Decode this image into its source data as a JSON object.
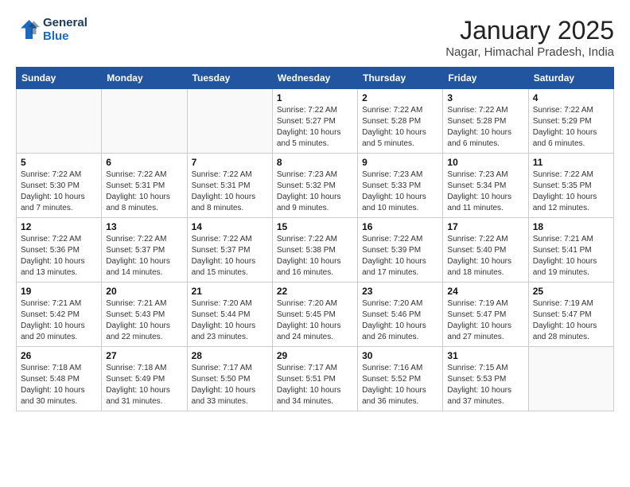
{
  "header": {
    "logo_line1": "General",
    "logo_line2": "Blue",
    "title": "January 2025",
    "subtitle": "Nagar, Himachal Pradesh, India"
  },
  "weekdays": [
    "Sunday",
    "Monday",
    "Tuesday",
    "Wednesday",
    "Thursday",
    "Friday",
    "Saturday"
  ],
  "weeks": [
    [
      {
        "day": "",
        "info": ""
      },
      {
        "day": "",
        "info": ""
      },
      {
        "day": "",
        "info": ""
      },
      {
        "day": "1",
        "info": "Sunrise: 7:22 AM\nSunset: 5:27 PM\nDaylight: 10 hours\nand 5 minutes."
      },
      {
        "day": "2",
        "info": "Sunrise: 7:22 AM\nSunset: 5:28 PM\nDaylight: 10 hours\nand 5 minutes."
      },
      {
        "day": "3",
        "info": "Sunrise: 7:22 AM\nSunset: 5:28 PM\nDaylight: 10 hours\nand 6 minutes."
      },
      {
        "day": "4",
        "info": "Sunrise: 7:22 AM\nSunset: 5:29 PM\nDaylight: 10 hours\nand 6 minutes."
      }
    ],
    [
      {
        "day": "5",
        "info": "Sunrise: 7:22 AM\nSunset: 5:30 PM\nDaylight: 10 hours\nand 7 minutes."
      },
      {
        "day": "6",
        "info": "Sunrise: 7:22 AM\nSunset: 5:31 PM\nDaylight: 10 hours\nand 8 minutes."
      },
      {
        "day": "7",
        "info": "Sunrise: 7:22 AM\nSunset: 5:31 PM\nDaylight: 10 hours\nand 8 minutes."
      },
      {
        "day": "8",
        "info": "Sunrise: 7:23 AM\nSunset: 5:32 PM\nDaylight: 10 hours\nand 9 minutes."
      },
      {
        "day": "9",
        "info": "Sunrise: 7:23 AM\nSunset: 5:33 PM\nDaylight: 10 hours\nand 10 minutes."
      },
      {
        "day": "10",
        "info": "Sunrise: 7:23 AM\nSunset: 5:34 PM\nDaylight: 10 hours\nand 11 minutes."
      },
      {
        "day": "11",
        "info": "Sunrise: 7:22 AM\nSunset: 5:35 PM\nDaylight: 10 hours\nand 12 minutes."
      }
    ],
    [
      {
        "day": "12",
        "info": "Sunrise: 7:22 AM\nSunset: 5:36 PM\nDaylight: 10 hours\nand 13 minutes."
      },
      {
        "day": "13",
        "info": "Sunrise: 7:22 AM\nSunset: 5:37 PM\nDaylight: 10 hours\nand 14 minutes."
      },
      {
        "day": "14",
        "info": "Sunrise: 7:22 AM\nSunset: 5:37 PM\nDaylight: 10 hours\nand 15 minutes."
      },
      {
        "day": "15",
        "info": "Sunrise: 7:22 AM\nSunset: 5:38 PM\nDaylight: 10 hours\nand 16 minutes."
      },
      {
        "day": "16",
        "info": "Sunrise: 7:22 AM\nSunset: 5:39 PM\nDaylight: 10 hours\nand 17 minutes."
      },
      {
        "day": "17",
        "info": "Sunrise: 7:22 AM\nSunset: 5:40 PM\nDaylight: 10 hours\nand 18 minutes."
      },
      {
        "day": "18",
        "info": "Sunrise: 7:21 AM\nSunset: 5:41 PM\nDaylight: 10 hours\nand 19 minutes."
      }
    ],
    [
      {
        "day": "19",
        "info": "Sunrise: 7:21 AM\nSunset: 5:42 PM\nDaylight: 10 hours\nand 20 minutes."
      },
      {
        "day": "20",
        "info": "Sunrise: 7:21 AM\nSunset: 5:43 PM\nDaylight: 10 hours\nand 22 minutes."
      },
      {
        "day": "21",
        "info": "Sunrise: 7:20 AM\nSunset: 5:44 PM\nDaylight: 10 hours\nand 23 minutes."
      },
      {
        "day": "22",
        "info": "Sunrise: 7:20 AM\nSunset: 5:45 PM\nDaylight: 10 hours\nand 24 minutes."
      },
      {
        "day": "23",
        "info": "Sunrise: 7:20 AM\nSunset: 5:46 PM\nDaylight: 10 hours\nand 26 minutes."
      },
      {
        "day": "24",
        "info": "Sunrise: 7:19 AM\nSunset: 5:47 PM\nDaylight: 10 hours\nand 27 minutes."
      },
      {
        "day": "25",
        "info": "Sunrise: 7:19 AM\nSunset: 5:47 PM\nDaylight: 10 hours\nand 28 minutes."
      }
    ],
    [
      {
        "day": "26",
        "info": "Sunrise: 7:18 AM\nSunset: 5:48 PM\nDaylight: 10 hours\nand 30 minutes."
      },
      {
        "day": "27",
        "info": "Sunrise: 7:18 AM\nSunset: 5:49 PM\nDaylight: 10 hours\nand 31 minutes."
      },
      {
        "day": "28",
        "info": "Sunrise: 7:17 AM\nSunset: 5:50 PM\nDaylight: 10 hours\nand 33 minutes."
      },
      {
        "day": "29",
        "info": "Sunrise: 7:17 AM\nSunset: 5:51 PM\nDaylight: 10 hours\nand 34 minutes."
      },
      {
        "day": "30",
        "info": "Sunrise: 7:16 AM\nSunset: 5:52 PM\nDaylight: 10 hours\nand 36 minutes."
      },
      {
        "day": "31",
        "info": "Sunrise: 7:15 AM\nSunset: 5:53 PM\nDaylight: 10 hours\nand 37 minutes."
      },
      {
        "day": "",
        "info": ""
      }
    ]
  ]
}
